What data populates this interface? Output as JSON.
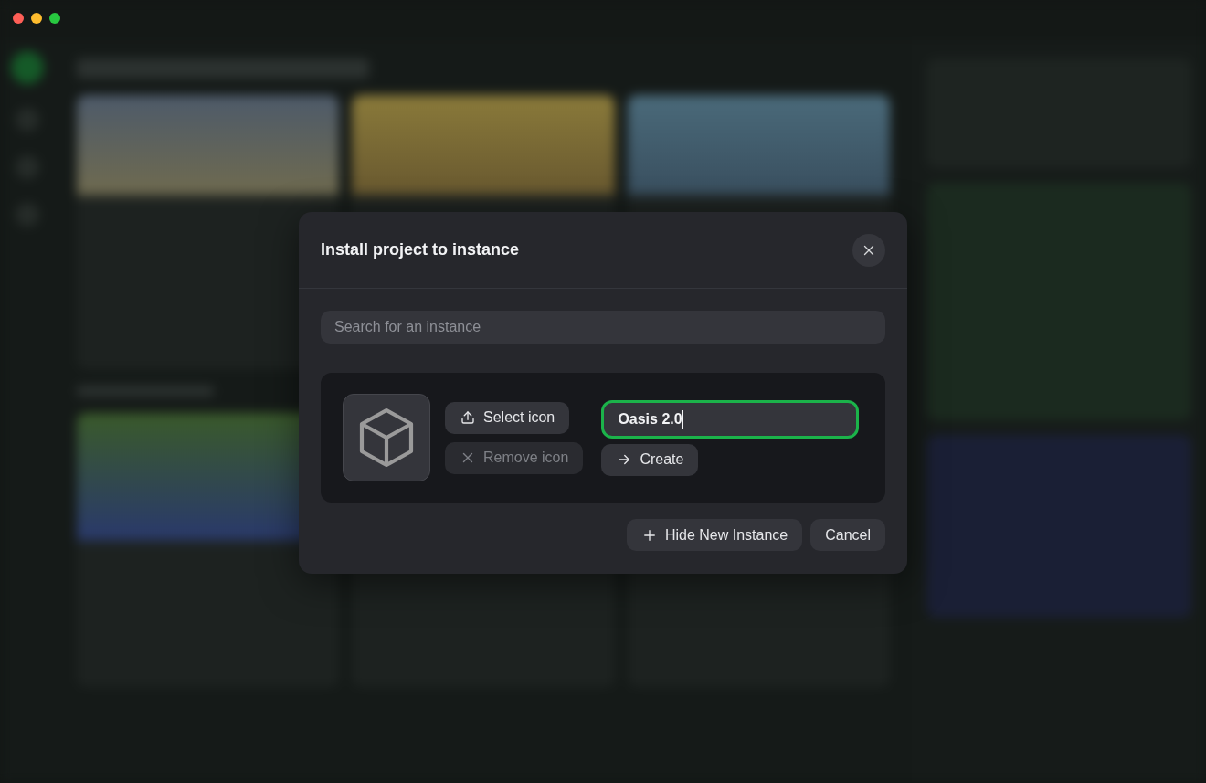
{
  "dialog": {
    "title": "Install project to instance",
    "search": {
      "placeholder": "Search for an instance"
    },
    "new_instance": {
      "icon_actions": [
        {
          "label": "Select icon",
          "kind": "upload",
          "disabled": false
        },
        {
          "label": "Remove icon",
          "kind": "remove",
          "disabled": true
        }
      ],
      "name_field": {
        "value": "Oasis 2.0",
        "focused": true
      },
      "create_button": {
        "label": "Create"
      }
    },
    "footer_buttons": [
      {
        "label": "Hide New Instance",
        "kind": "plus"
      },
      {
        "label": "Cancel",
        "kind": "plain"
      }
    ]
  }
}
